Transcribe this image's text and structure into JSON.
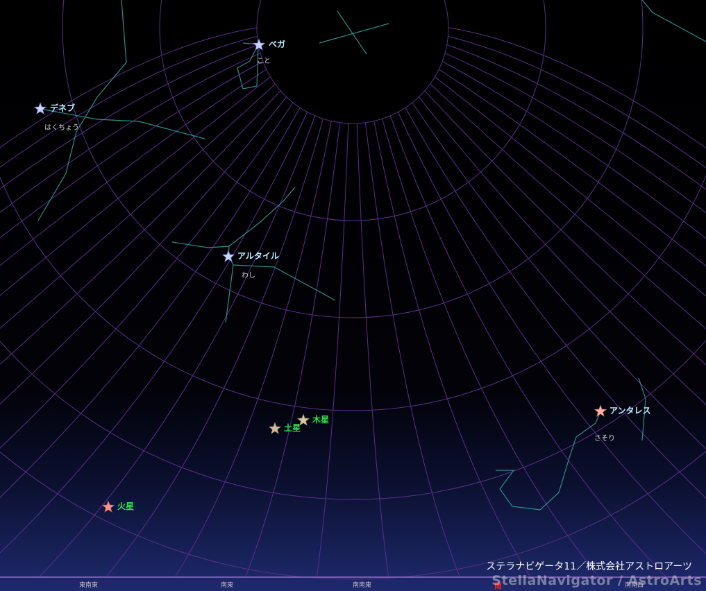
{
  "stars": [
    {
      "id": "vega",
      "name": "ベガ",
      "constellation": "こと",
      "color": "#c8d4ff"
    },
    {
      "id": "deneb",
      "name": "デネブ",
      "constellation": "はくちょう",
      "color": "#c8d4ff"
    },
    {
      "id": "altair",
      "name": "アルタイル",
      "constellation": "わし",
      "color": "#c8d4ff"
    },
    {
      "id": "antares",
      "name": "アンタレス",
      "constellation": "さそり",
      "color": "#ffb0a0"
    }
  ],
  "planets": [
    {
      "id": "jupiter",
      "name": "木星",
      "color": "#d8c8a0"
    },
    {
      "id": "saturn",
      "name": "土星",
      "color": "#c8c0a0"
    },
    {
      "id": "mars",
      "name": "火星",
      "color": "#ff9090"
    }
  ],
  "directions": [
    {
      "id": "ese",
      "label": "東南東"
    },
    {
      "id": "se",
      "label": "南東"
    },
    {
      "id": "sse",
      "label": "南南東"
    },
    {
      "id": "s",
      "label": "南"
    },
    {
      "id": "ssw",
      "label": "南南西"
    }
  ],
  "credit": {
    "line1": "ステラナビゲータ11／株式会社アストロアーツ",
    "line2": "StellaNavigator / AstroArts"
  },
  "colors": {
    "grid": "#5a2f8a",
    "constellation_line": "#2b8f8a",
    "horizon_glow": "#1e2a6e",
    "south_marker": "#ff2020"
  }
}
